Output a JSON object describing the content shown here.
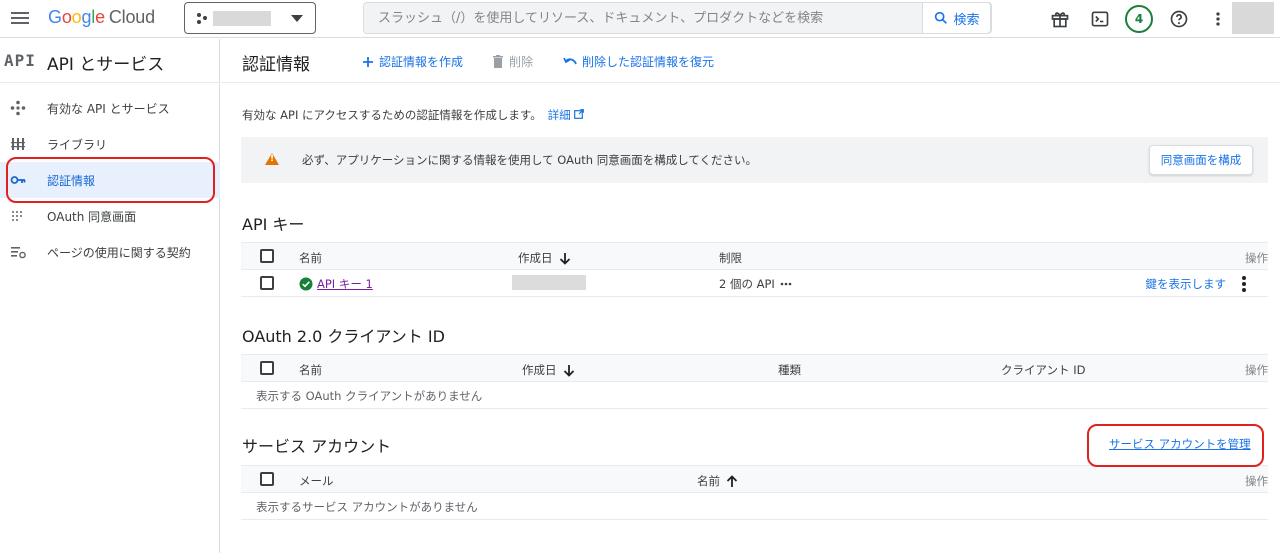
{
  "topbar": {
    "logo_letters": [
      "G",
      "o",
      "o",
      "g",
      "l",
      "e"
    ],
    "logo_product": "Cloud",
    "search_placeholder": "スラッシュ（/）を使用してリソース、ドキュメント、プロダクトなどを検索",
    "search_button": "検索",
    "notification_count": "4"
  },
  "sidebar": {
    "mark": "API",
    "title": "API とサービス",
    "items": [
      {
        "label": "有効な API とサービス",
        "icon": "apis-icon",
        "active": false
      },
      {
        "label": "ライブラリ",
        "icon": "library-icon",
        "active": false
      },
      {
        "label": "認証情報",
        "icon": "key-icon",
        "active": true
      },
      {
        "label": "OAuth 同意画面",
        "icon": "oauth-icon",
        "active": false
      },
      {
        "label": "ページの使用に関する契約",
        "icon": "agreements-icon",
        "active": false
      }
    ]
  },
  "main": {
    "title": "認証情報",
    "toolbar": {
      "create": "認証情報を作成",
      "delete": "削除",
      "restore": "削除した認証情報を復元"
    },
    "intro": "有効な API にアクセスするための認証情報を作成します。",
    "intro_link": "詳細",
    "warning": {
      "text": "必ず、アプリケーションに関する情報を使用して OAuth 同意画面を構成してください。",
      "button": "同意画面を構成"
    },
    "api_keys": {
      "title": "API キー",
      "headers": {
        "name": "名前",
        "created": "作成日",
        "restriction": "制限",
        "actions": "操作"
      },
      "rows": [
        {
          "name": "API キー 1",
          "restriction": "2 個の API",
          "show_key": "鍵を表示します"
        }
      ]
    },
    "oauth": {
      "title": "OAuth 2.0 クライアント ID",
      "headers": {
        "name": "名前",
        "created": "作成日",
        "type": "種類",
        "client_id": "クライアント ID",
        "actions": "操作"
      },
      "empty": "表示する OAuth クライアントがありません"
    },
    "service_accounts": {
      "title": "サービス アカウント",
      "manage": "サービス アカウントを管理",
      "headers": {
        "email": "メール",
        "name": "名前",
        "actions": "操作"
      },
      "empty": "表示するサービス アカウントがありません"
    }
  },
  "colors": {
    "accent": "#1a73e8",
    "highlight": "#e1211f",
    "warning": "#e37400",
    "badge": "#188038"
  }
}
